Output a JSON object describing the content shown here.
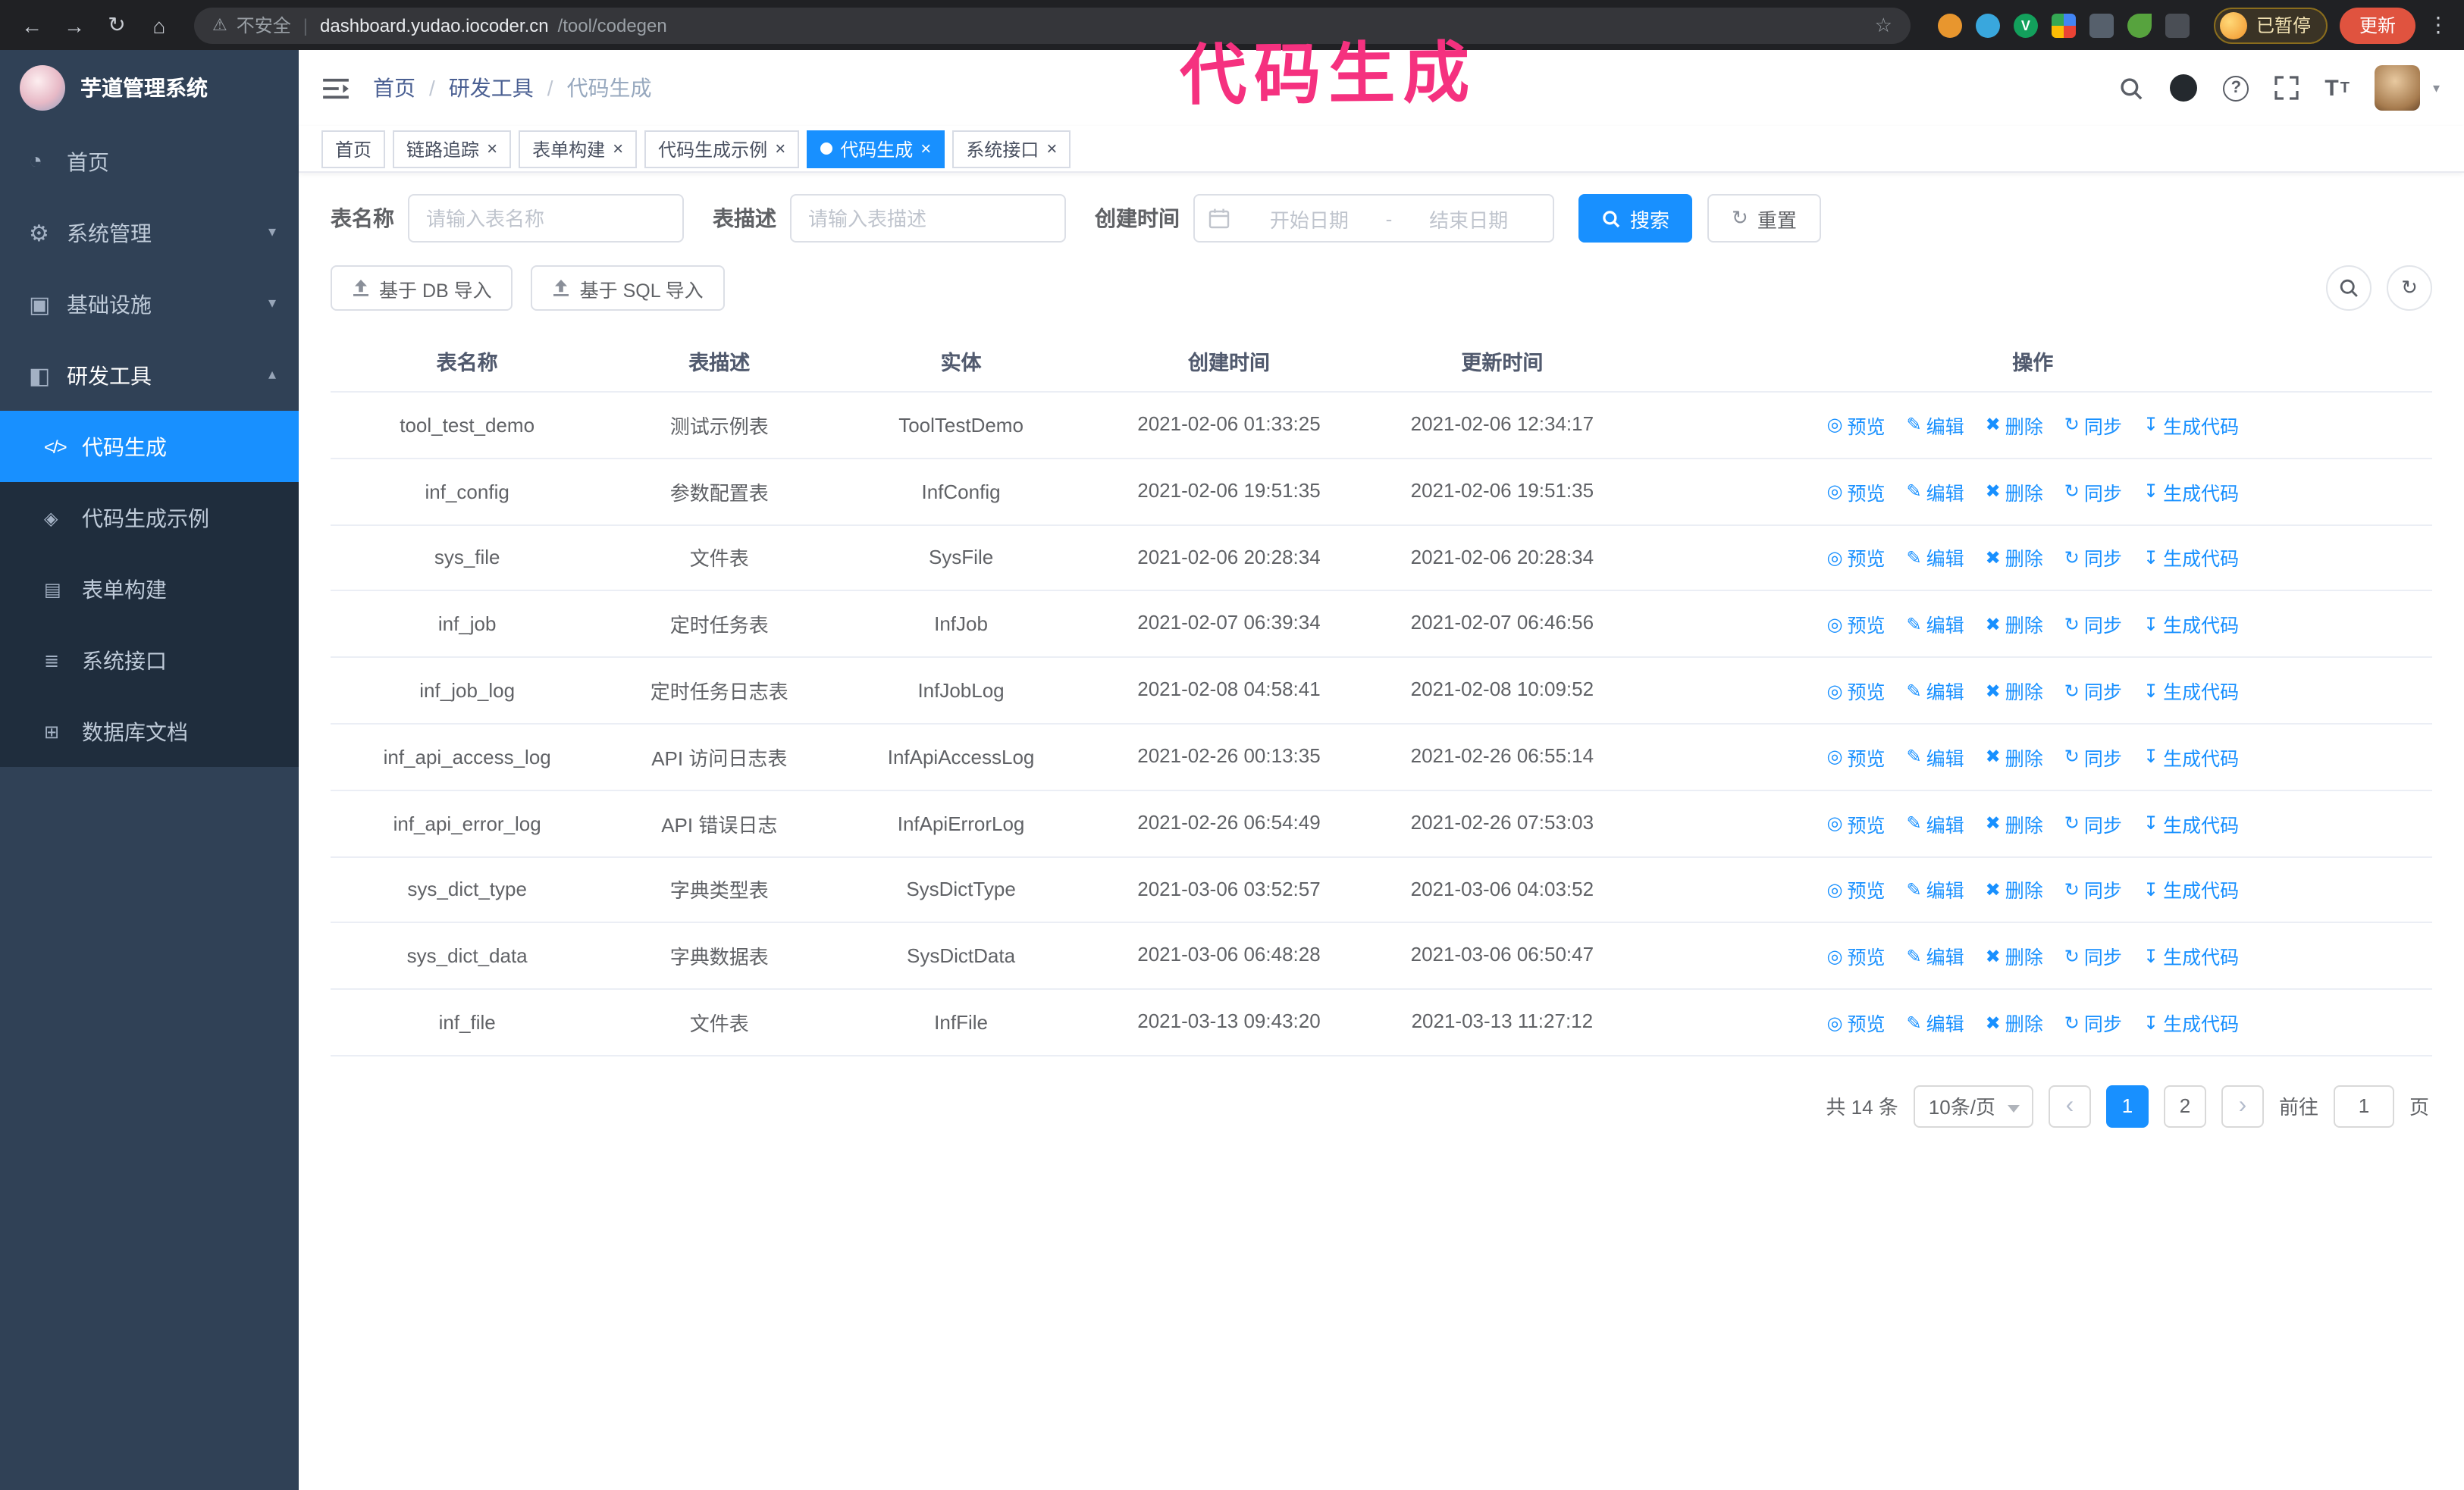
{
  "glyphs": {
    "back": "←",
    "forward": "→",
    "reload": "↻",
    "home": "⌂",
    "warning": "⚠",
    "pipe": "|",
    "star": "☆",
    "kebab": "⋮",
    "help": "?",
    "font_t": "T",
    "caret_down": "▾",
    "caret_up": "▴",
    "close": "×",
    "slash": "/",
    "refresh": "↻",
    "prev": "‹",
    "next": "›"
  },
  "annotation": {
    "text": "代码生成",
    "color": "#f5317f"
  },
  "browser": {
    "security_label": "不安全",
    "url_host": "dashboard.yudao.iocoder.cn",
    "url_path": "/tool/codegen",
    "paused_badge": "已暂停",
    "update_button": "更新"
  },
  "sidebar": {
    "logo_title": "芋道管理系统",
    "items": [
      {
        "key": "home",
        "label": "首页",
        "icon": "dashboard-icon",
        "glyph": "◔",
        "expandable": false,
        "expanded": false
      },
      {
        "key": "system",
        "label": "系统管理",
        "icon": "gear-icon",
        "glyph": "⚙",
        "expandable": true,
        "expanded": false
      },
      {
        "key": "infrastructure",
        "label": "基础设施",
        "icon": "infrastructure-icon",
        "glyph": "▣",
        "expandable": true,
        "expanded": false
      },
      {
        "key": "devtools",
        "label": "研发工具",
        "icon": "tools-icon",
        "glyph": "◧",
        "expandable": true,
        "expanded": true
      }
    ],
    "subitems": [
      {
        "key": "codegen",
        "label": "代码生成",
        "icon": "code-icon",
        "glyph": "</>",
        "active": true
      },
      {
        "key": "codegen-example",
        "label": "代码生成示例",
        "icon": "example-icon",
        "glyph": "◈",
        "active": false
      },
      {
        "key": "form-builder",
        "label": "表单构建",
        "icon": "form-icon",
        "glyph": "▤",
        "active": false
      },
      {
        "key": "api",
        "label": "系统接口",
        "icon": "api-icon",
        "glyph": "≣",
        "active": false
      },
      {
        "key": "db-doc",
        "label": "数据库文档",
        "icon": "database-icon",
        "glyph": "⊞",
        "active": false
      }
    ]
  },
  "header": {
    "breadcrumb": [
      {
        "label": "首页"
      },
      {
        "label": "研发工具"
      },
      {
        "label": "代码生成"
      }
    ]
  },
  "tabs": [
    {
      "key": "home",
      "label": "首页",
      "closable": false,
      "active": false
    },
    {
      "key": "tracing",
      "label": "链路追踪",
      "closable": true,
      "active": false
    },
    {
      "key": "form-builder",
      "label": "表单构建",
      "closable": true,
      "active": false
    },
    {
      "key": "codegen-example",
      "label": "代码生成示例",
      "closable": true,
      "active": false
    },
    {
      "key": "codegen",
      "label": "代码生成",
      "closable": true,
      "active": true
    },
    {
      "key": "api",
      "label": "系统接口",
      "closable": true,
      "active": false
    }
  ],
  "filters": {
    "table_name_label": "表名称",
    "table_name_placeholder": "请输入表名称",
    "table_desc_label": "表描述",
    "table_desc_placeholder": "请输入表描述",
    "create_time_label": "创建时间",
    "start_date_placeholder": "开始日期",
    "range_separator": "-",
    "end_date_placeholder": "结束日期",
    "search_button": "搜索",
    "reset_button": "重置"
  },
  "toolbar": {
    "import_db": "基于 DB 导入",
    "import_sql": "基于 SQL 导入"
  },
  "table": {
    "columns": [
      "表名称",
      "表描述",
      "实体",
      "创建时间",
      "更新时间",
      "操作"
    ],
    "actions": [
      {
        "key": "preview",
        "label": "预览",
        "icon": "eye-icon",
        "glyph": "◎"
      },
      {
        "key": "edit",
        "label": "编辑",
        "icon": "edit-icon",
        "glyph": "✎"
      },
      {
        "key": "delete",
        "label": "删除",
        "icon": "delete-icon",
        "glyph": "✖"
      },
      {
        "key": "sync",
        "label": "同步",
        "icon": "sync-icon",
        "glyph": "↻"
      },
      {
        "key": "generate",
        "label": "生成代码",
        "icon": "download-icon",
        "glyph": "↧"
      }
    ],
    "rows": [
      {
        "name": "tool_test_demo",
        "desc": "测试示例表",
        "entity": "ToolTestDemo",
        "created": "2021-02-06 01:33:25",
        "updated": "2021-02-06 12:34:17"
      },
      {
        "name": "inf_config",
        "desc": "参数配置表",
        "entity": "InfConfig",
        "created": "2021-02-06 19:51:35",
        "updated": "2021-02-06 19:51:35"
      },
      {
        "name": "sys_file",
        "desc": "文件表",
        "entity": "SysFile",
        "created": "2021-02-06 20:28:34",
        "updated": "2021-02-06 20:28:34"
      },
      {
        "name": "inf_job",
        "desc": "定时任务表",
        "entity": "InfJob",
        "created": "2021-02-07 06:39:34",
        "updated": "2021-02-07 06:46:56"
      },
      {
        "name": "inf_job_log",
        "desc": "定时任务日志表",
        "entity": "InfJobLog",
        "created": "2021-02-08 04:58:41",
        "updated": "2021-02-08 10:09:52"
      },
      {
        "name": "inf_api_access_log",
        "desc": "API 访问日志表",
        "entity": "InfApiAccessLog",
        "created": "2021-02-26 00:13:35",
        "updated": "2021-02-26 06:55:14"
      },
      {
        "name": "inf_api_error_log",
        "desc": "API 错误日志",
        "entity": "InfApiErrorLog",
        "created": "2021-02-26 06:54:49",
        "updated": "2021-02-26 07:53:03"
      },
      {
        "name": "sys_dict_type",
        "desc": "字典类型表",
        "entity": "SysDictType",
        "created": "2021-03-06 03:52:57",
        "updated": "2021-03-06 04:03:52"
      },
      {
        "name": "sys_dict_data",
        "desc": "字典数据表",
        "entity": "SysDictData",
        "created": "2021-03-06 06:48:28",
        "updated": "2021-03-06 06:50:47"
      },
      {
        "name": "inf_file",
        "desc": "文件表",
        "entity": "InfFile",
        "created": "2021-03-13 09:43:20",
        "updated": "2021-03-13 11:27:12"
      }
    ]
  },
  "pagination": {
    "total_text": "共 14 条",
    "page_size": "10条/页",
    "pages": [
      "1",
      "2"
    ],
    "active_page": "1",
    "goto_label": "前往",
    "goto_value": "1",
    "goto_suffix": "页"
  },
  "colors": {
    "accent": "#1890ff",
    "sidebar_bg": "#304156",
    "submenu_bg": "#1f2d3d",
    "annotation": "#f5317f",
    "chrome_bg": "#202124"
  }
}
